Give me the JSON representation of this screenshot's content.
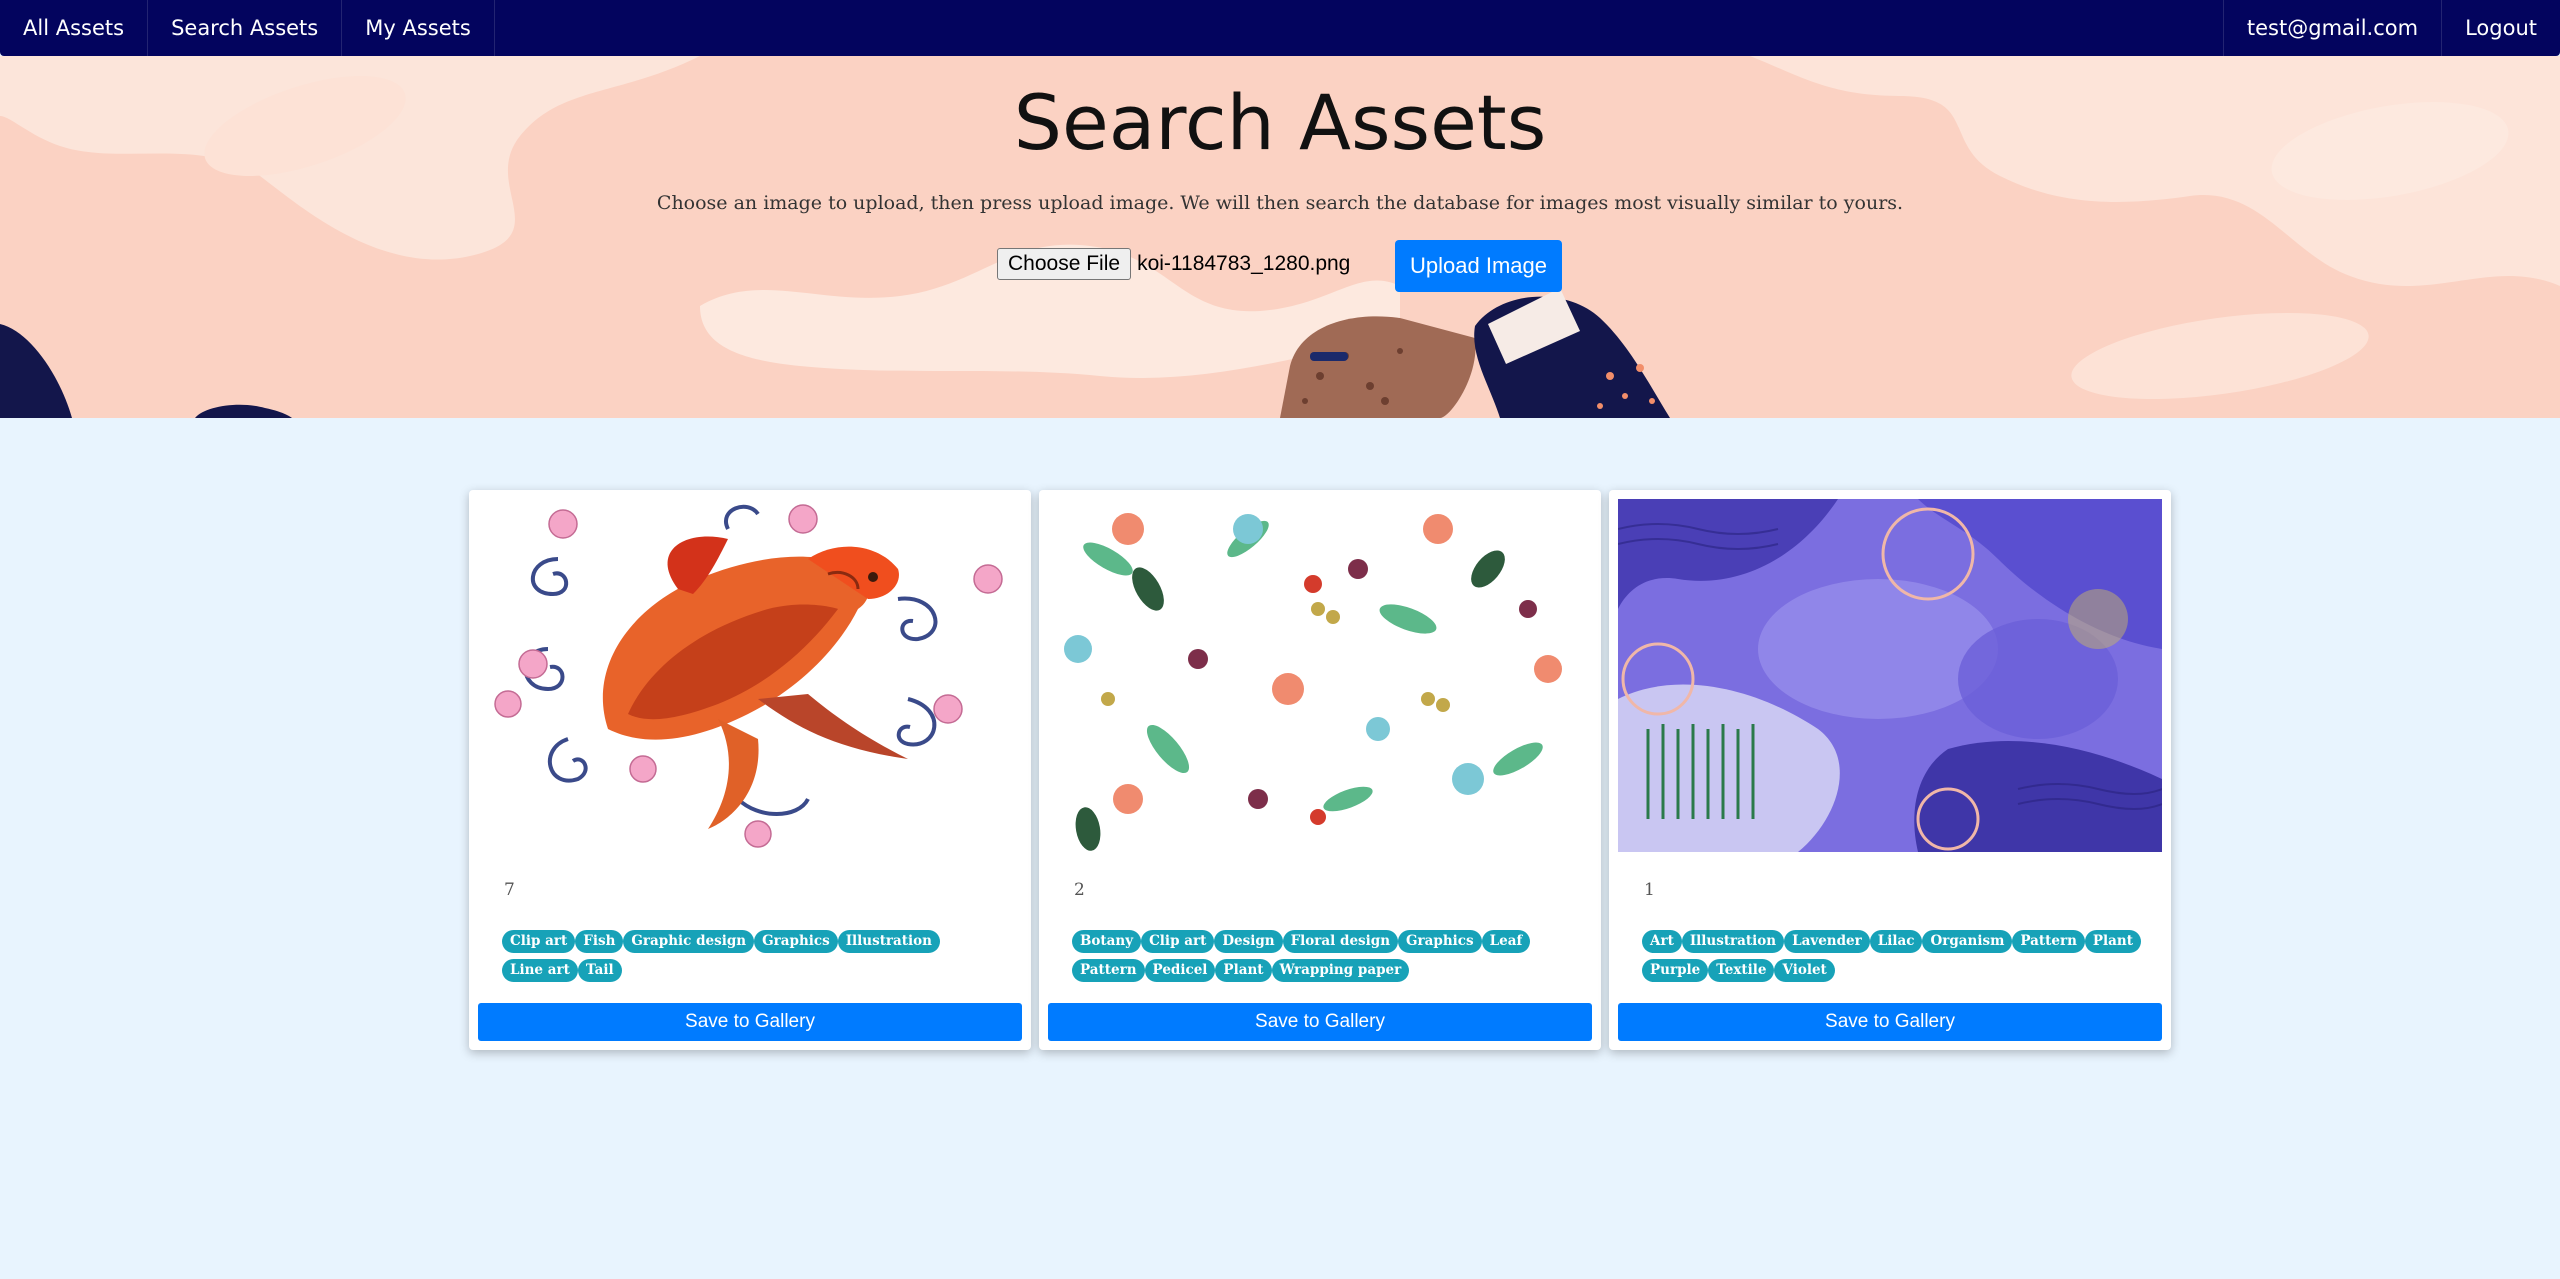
{
  "nav": {
    "left": [
      "All Assets",
      "Search Assets",
      "My Assets"
    ],
    "user_email": "test@gmail.com",
    "logout": "Logout"
  },
  "hero": {
    "title": "Search Assets",
    "description": "Choose an image to upload, then press upload image. We will then search the database for images most visually similar to yours.",
    "choose_file_label": "Choose File",
    "file_name": "koi-1184783_1280.png",
    "upload_label": "Upload Image"
  },
  "colors": {
    "navbar": "#03045e",
    "hero_bg": "#fbd2c3",
    "page_bg": "#e8f4fe",
    "primary": "#007bff",
    "tag": "#17a2b8"
  },
  "results": [
    {
      "image": "koi-fish-illustration",
      "count": "7",
      "tags": [
        "Clip art",
        "Fish",
        "Graphic design",
        "Graphics",
        "Illustration",
        "Line art",
        "Tail"
      ],
      "save_label": "Save to Gallery"
    },
    {
      "image": "floral-pattern",
      "count": "2",
      "tags": [
        "Botany",
        "Clip art",
        "Design",
        "Floral design",
        "Graphics",
        "Leaf",
        "Pattern",
        "Pedicel",
        "Plant",
        "Wrapping paper"
      ],
      "save_label": "Save to Gallery"
    },
    {
      "image": "purple-abstract-textile",
      "count": "1",
      "tags": [
        "Art",
        "Illustration",
        "Lavender",
        "Lilac",
        "Organism",
        "Pattern",
        "Plant",
        "Purple",
        "Textile",
        "Violet"
      ],
      "save_label": "Save to Gallery"
    }
  ]
}
